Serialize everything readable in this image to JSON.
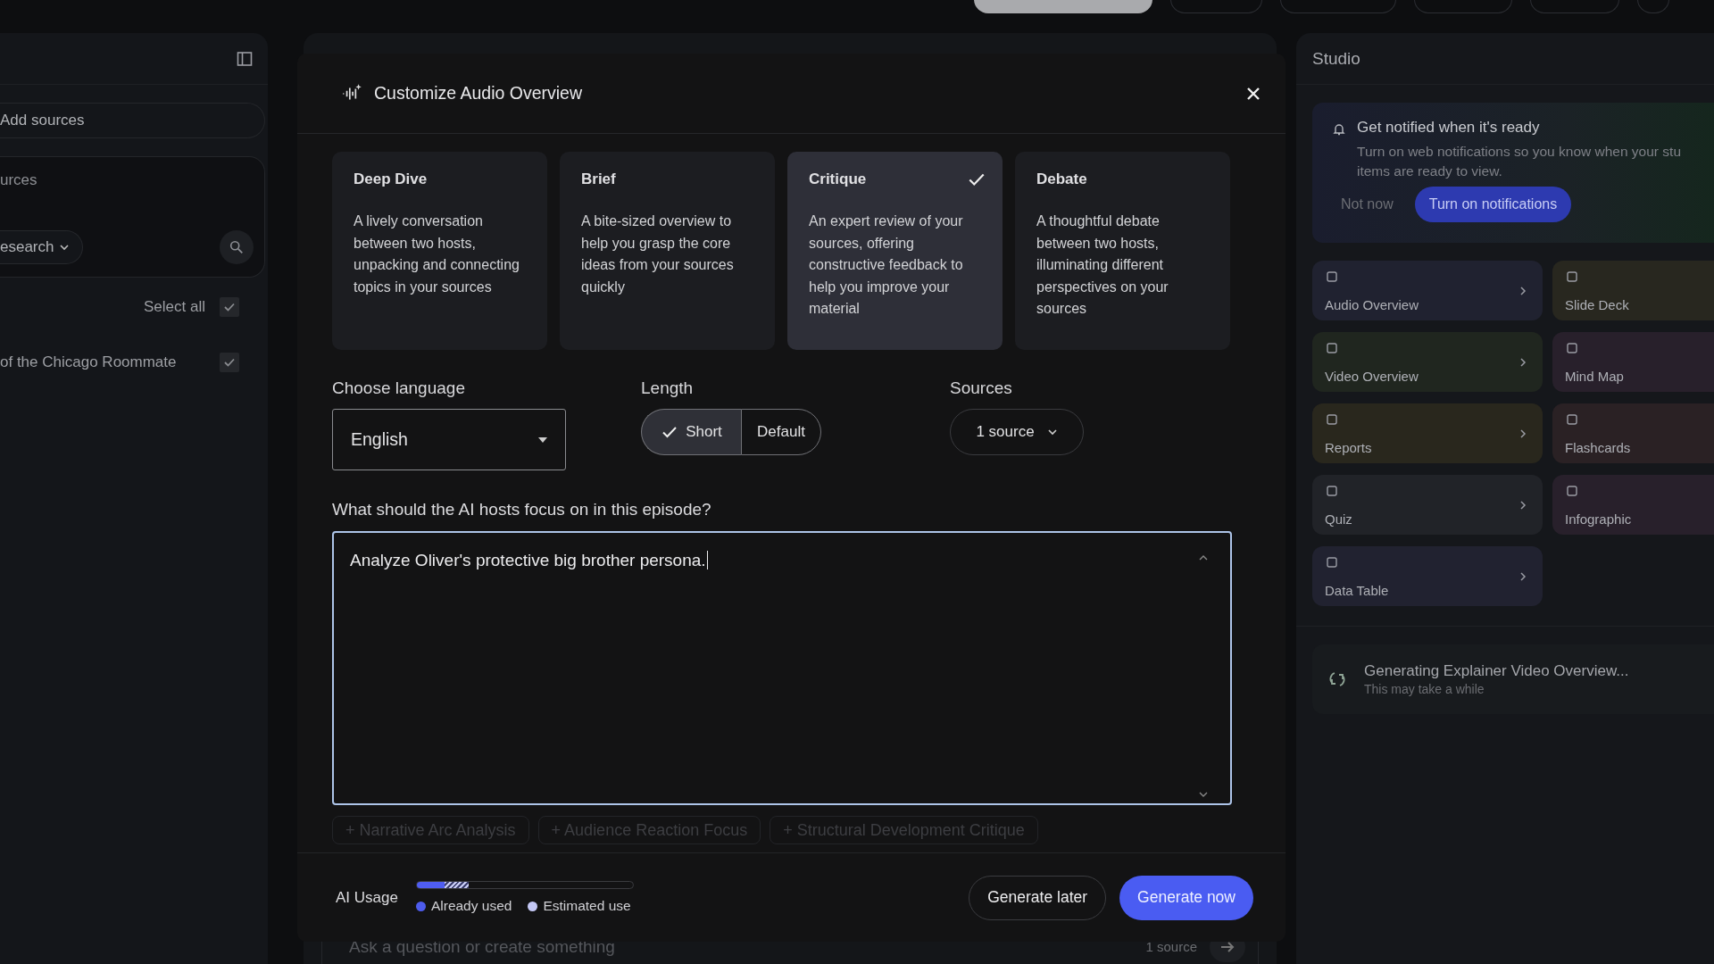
{
  "sources_panel": {
    "add_button": "Add sources",
    "search_text": "urces",
    "search_mode": "esearch",
    "select_all": {
      "label": "Select all",
      "checked": true
    },
    "sources": [
      {
        "title": "of the Chicago Roommate",
        "checked": true
      }
    ]
  },
  "chat": {
    "input_placeholder": "Ask a question or create something",
    "source_count": "1 source"
  },
  "dialog": {
    "title": "Customize Audio Overview",
    "formats": [
      {
        "title": "Deep Dive",
        "description": "A lively conversation between two hosts, unpacking and connecting topics in your sources",
        "selected": false
      },
      {
        "title": "Brief",
        "description": "A bite-sized overview to help you grasp the core ideas from your sources quickly",
        "selected": false
      },
      {
        "title": "Critique",
        "description": "An expert review of your sources, offering constructive feedback to help you improve your material",
        "selected": true
      },
      {
        "title": "Debate",
        "description": "A thoughtful debate between two hosts, illuminating different perspectives on your sources",
        "selected": false
      }
    ],
    "language": {
      "label": "Choose language",
      "value": "English"
    },
    "length": {
      "label": "Length",
      "options": [
        {
          "label": "Short",
          "selected": true
        },
        {
          "label": "Default",
          "selected": false
        }
      ]
    },
    "sources": {
      "label": "Sources",
      "value": "1 source"
    },
    "focus": {
      "label": "What should the AI hosts focus on in this episode?",
      "value": "Analyze Oliver's protective big brother persona."
    },
    "suggestions": [
      "+ Narrative Arc Analysis",
      "+ Audience Reaction Focus",
      "+ Structural Development Critique"
    ],
    "usage": {
      "label": "AI Usage",
      "used": {
        "label": "Already used",
        "level": 0.13
      },
      "estimated": {
        "label": "Estimated use",
        "level": 0.11
      }
    },
    "buttons": {
      "later": "Generate later",
      "now": "Generate now"
    }
  },
  "studio": {
    "title": "Studio",
    "notice": {
      "title": "Get notified when it's ready",
      "text": "Turn on web notifications so you know when your stu",
      "text_2": "items are ready to view.",
      "dismiss": "Not now",
      "action": "Turn on notifications"
    },
    "tiles_left": [
      {
        "label": "Audio Overview",
        "color": "#202230"
      },
      {
        "label": "Video Overview",
        "color": "#20261f"
      },
      {
        "label": "Reports",
        "color": "#29271d"
      },
      {
        "label": "Quiz",
        "color": "#212328"
      },
      {
        "label": "Data Table",
        "color": "#212230"
      }
    ],
    "tiles_right": [
      {
        "label": "Slide Deck",
        "color": "#28271f"
      },
      {
        "label": "Mind Map",
        "color": "#28202b"
      },
      {
        "label": "Flashcards",
        "color": "#2a2124"
      },
      {
        "label": "Infographic",
        "color": "#28202b"
      }
    ],
    "progress": {
      "title": "Generating Explainer Video Overview...",
      "subtitle": "This may take a while"
    }
  }
}
